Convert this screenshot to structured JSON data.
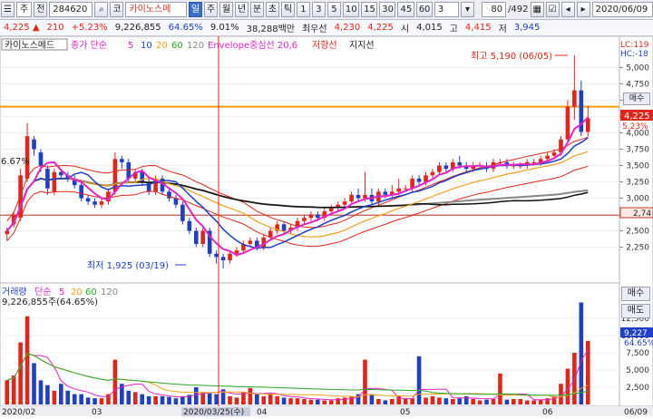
{
  "toolbar": {
    "market": "주",
    "prev_label": "전",
    "code": "284620",
    "stock_name": "카이노스메",
    "type_label": "코",
    "periods": [
      "일",
      "주",
      "월",
      "년",
      "분",
      "초",
      "틱"
    ],
    "active_period": "일",
    "intervals": [
      "1",
      "3",
      "5",
      "10",
      "15",
      "30",
      "45",
      "60"
    ],
    "interval_select": "3",
    "count": "80",
    "total": "/492",
    "date": "2020/06/09"
  },
  "info": {
    "price": "4,225",
    "change": "210",
    "change_pct": "+5.23%",
    "volume": "9,226,855",
    "turnover_pct": "64.65%",
    "vol_ratio": "9.01%",
    "amount": "38,288백만",
    "best_label": "최우선",
    "ask": "4,230",
    "bid": "4,225",
    "open_label": "시",
    "open": "4,015",
    "high_label": "고",
    "high": "4,415",
    "low_label": "저",
    "low": "3,945"
  },
  "price_legend": {
    "name": "카이노스메드",
    "ma_label": "종가 단순",
    "ma": [
      "5",
      "10",
      "20",
      "60",
      "120"
    ],
    "envelope": "Envelope중심선 20,6",
    "resist": "저항선",
    "support": "지지선",
    "lc": "LC:119",
    "hc": "HC:-18"
  },
  "volume_legend": {
    "name": "거래량",
    "ma_label": "단순",
    "ma": [
      "5",
      "20",
      "60",
      "120"
    ],
    "value_text": "9,226,855주(64.65%)"
  },
  "annotations": {
    "high": "최고 5,190 (06/05)",
    "low": "최저 1,925 (03/19)",
    "pct_left": "6.67%",
    "price_tag": "4,225",
    "price_tag_pct": "5.23%",
    "support_tag": "2,74",
    "vol_tag": "9,227",
    "vol_tag_pct": "64.65%"
  },
  "price_axis": [
    "5,000",
    "4,750",
    "4,500",
    "4,250",
    "4,000",
    "3,750",
    "3,500",
    "3,250",
    "3,000",
    "2,750",
    "2,500",
    "2,250"
  ],
  "volume_axis": [
    "12,500",
    "10,000",
    "7,500",
    "5,000",
    "2,500"
  ],
  "date_axis": [
    "2020/02",
    "03",
    "2020/03/25(수)",
    "04",
    "05",
    "06",
    "06/09"
  ],
  "buttons": {
    "buy": "매수",
    "buy_small": "매수",
    "sell": "매도"
  },
  "colors": {
    "up": "#e0261b",
    "down": "#1f3fc4",
    "ma5": "#e225c8",
    "ma10": "#1f3fc4",
    "ma20": "#f0a020",
    "ma60": "#2aa82a",
    "ma120": "#888888",
    "resist": "#f39c12",
    "support": "#c0392b"
  },
  "chart_data": {
    "type": "candlestick",
    "dates": [
      "02/04",
      "02/05",
      "02/06",
      "02/07",
      "02/10",
      "02/11",
      "02/12",
      "02/13",
      "02/14",
      "02/17",
      "02/18",
      "02/19",
      "02/20",
      "02/21",
      "02/24",
      "02/25",
      "02/26",
      "02/27",
      "02/28",
      "03/02",
      "03/03",
      "03/04",
      "03/05",
      "03/06",
      "03/09",
      "03/10",
      "03/11",
      "03/12",
      "03/13",
      "03/16",
      "03/17",
      "03/18",
      "03/19",
      "03/20",
      "03/23",
      "03/24",
      "03/25",
      "03/26",
      "03/27",
      "03/30",
      "03/31",
      "04/01",
      "04/02",
      "04/03",
      "04/06",
      "04/07",
      "04/08",
      "04/09",
      "04/10",
      "04/13",
      "04/14",
      "04/16",
      "04/17",
      "04/20",
      "04/21",
      "04/22",
      "04/23",
      "04/24",
      "04/27",
      "04/28",
      "04/29",
      "05/04",
      "05/06",
      "05/07",
      "05/08",
      "05/11",
      "05/12",
      "05/13",
      "05/14",
      "05/15",
      "05/18",
      "05/19",
      "05/20",
      "05/21",
      "05/22",
      "05/25",
      "05/26",
      "05/27",
      "05/28",
      "05/29",
      "06/01",
      "06/02",
      "06/03",
      "06/04",
      "06/05",
      "06/08",
      "06/09"
    ],
    "open": [
      2450,
      2600,
      2700,
      3300,
      3900,
      3700,
      3450,
      3100,
      3400,
      3350,
      3300,
      3200,
      3000,
      2950,
      2900,
      2950,
      3100,
      3600,
      3550,
      3300,
      3400,
      3250,
      3100,
      3300,
      3100,
      3000,
      2900,
      2650,
      2500,
      2300,
      2500,
      2150,
      2100,
      2050,
      2150,
      2200,
      2300,
      2350,
      2250,
      2400,
      2500,
      2600,
      2500,
      2550,
      2650,
      2700,
      2750,
      2700,
      2800,
      2850,
      2900,
      2950,
      3050,
      3000,
      3050,
      2950,
      3100,
      3050,
      3100,
      3150,
      3150,
      3300,
      3250,
      3350,
      3400,
      3500,
      3450,
      3550,
      3500,
      3450,
      3500,
      3500,
      3450,
      3550,
      3550,
      3500,
      3500,
      3500,
      3550,
      3550,
      3600,
      3650,
      3700,
      3900,
      4400,
      4650,
      4015
    ],
    "close": [
      2500,
      2750,
      3350,
      3950,
      3750,
      3500,
      3150,
      3400,
      3350,
      3300,
      3200,
      3000,
      2950,
      2900,
      2950,
      3100,
      3600,
      3550,
      3300,
      3400,
      3250,
      3100,
      3300,
      3100,
      3000,
      2900,
      2650,
      2500,
      2300,
      2500,
      2150,
      2100,
      2050,
      2150,
      2200,
      2300,
      2350,
      2250,
      2400,
      2500,
      2600,
      2500,
      2550,
      2650,
      2700,
      2750,
      2700,
      2800,
      2850,
      2900,
      2950,
      3050,
      3000,
      3050,
      2950,
      3100,
      3050,
      3100,
      3150,
      3150,
      3300,
      3250,
      3350,
      3400,
      3500,
      3450,
      3550,
      3500,
      3450,
      3500,
      3500,
      3450,
      3550,
      3550,
      3500,
      3500,
      3500,
      3550,
      3550,
      3600,
      3650,
      3700,
      3900,
      4400,
      4650,
      4015,
      4225
    ],
    "high": [
      2550,
      2800,
      3450,
      4150,
      3950,
      3750,
      3500,
      3450,
      3450,
      3400,
      3350,
      3250,
      3050,
      3000,
      3000,
      3150,
      3700,
      3650,
      3600,
      3450,
      3450,
      3300,
      3350,
      3350,
      3150,
      3050,
      2950,
      2700,
      2550,
      2550,
      2550,
      2200,
      2150,
      2200,
      2250,
      2350,
      2400,
      2400,
      2450,
      2550,
      2650,
      2650,
      2600,
      2700,
      2750,
      2800,
      2800,
      2850,
      2900,
      2950,
      3000,
      3100,
      3150,
      3400,
      3150,
      3150,
      3150,
      3200,
      3300,
      3200,
      3350,
      3350,
      3400,
      3450,
      3550,
      3550,
      3600,
      3650,
      3550,
      3550,
      3550,
      3550,
      3600,
      3600,
      3600,
      3550,
      3550,
      3600,
      3600,
      3650,
      3700,
      3750,
      3950,
      4500,
      5190,
      4800,
      4415
    ],
    "low": [
      2350,
      2550,
      2650,
      3250,
      3650,
      3400,
      3050,
      3050,
      3300,
      3250,
      3150,
      2950,
      2900,
      2850,
      2850,
      2900,
      3050,
      3450,
      3250,
      3250,
      3200,
      3050,
      3050,
      3050,
      2950,
      2850,
      2600,
      2450,
      2250,
      2250,
      2100,
      2000,
      1925,
      2000,
      2100,
      2150,
      2250,
      2200,
      2200,
      2350,
      2450,
      2450,
      2450,
      2500,
      2600,
      2650,
      2650,
      2650,
      2750,
      2800,
      2850,
      2900,
      2950,
      2950,
      2900,
      2900,
      3000,
      3000,
      3050,
      3100,
      3100,
      3200,
      3200,
      3300,
      3350,
      3400,
      3400,
      3450,
      3400,
      3400,
      3450,
      3400,
      3400,
      3500,
      3450,
      3450,
      3450,
      3450,
      3500,
      3500,
      3550,
      3600,
      3650,
      3850,
      4200,
      3950,
      3945
    ],
    "volume": [
      3500,
      4200,
      9000,
      12800,
      6000,
      3500,
      2800,
      2000,
      3000,
      2000,
      1500,
      1500,
      1000,
      900,
      900,
      1500,
      6500,
      3000,
      2000,
      1800,
      1500,
      1200,
      1200,
      1200,
      1100,
      900,
      1200,
      1400,
      2500,
      1800,
      1600,
      1500,
      2200,
      1200,
      1000,
      1800,
      2400,
      1500,
      1200,
      1500,
      1200,
      1000,
      900,
      900,
      800,
      700,
      700,
      600,
      600,
      900,
      1000,
      1200,
      1500,
      6500,
      1500,
      800,
      600,
      800,
      1200,
      800,
      900,
      7000,
      1000,
      1200,
      1000,
      900,
      800,
      900,
      1200,
      800,
      600,
      700,
      800,
      4500,
      700,
      800,
      800,
      600,
      600,
      700,
      900,
      1200,
      3000,
      5200,
      7500,
      14800,
      9227
    ],
    "price_ylim": [
      1800,
      5200
    ],
    "volume_ylim": [
      0,
      15000
    ],
    "resistance": 4400,
    "support": 2740
  }
}
